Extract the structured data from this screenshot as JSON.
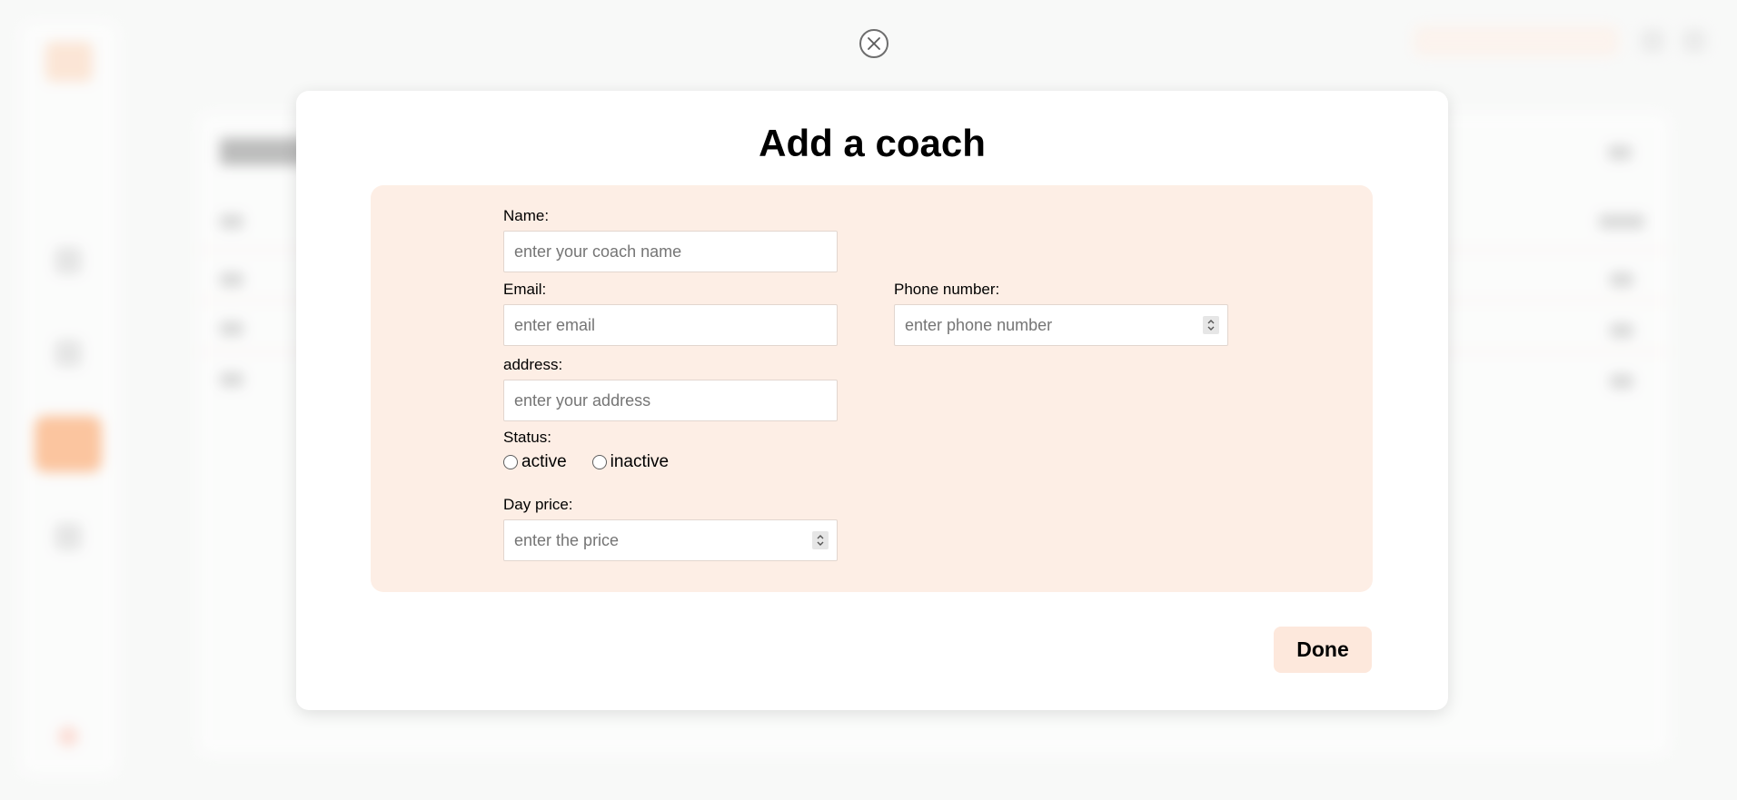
{
  "modal": {
    "title": "Add a coach",
    "close_icon": "close-circle-icon",
    "done_label": "Done"
  },
  "form": {
    "name": {
      "label": "Name:",
      "placeholder": "enter your coach name"
    },
    "email": {
      "label": "Email:",
      "placeholder": "enter email"
    },
    "phone": {
      "label": "Phone number:",
      "placeholder": "enter phone number"
    },
    "address": {
      "label": "address:",
      "placeholder": "enter your address"
    },
    "status": {
      "label": "Status:",
      "options": [
        "active",
        "inactive"
      ]
    },
    "day_price": {
      "label": "Day price:",
      "placeholder": "enter the price"
    }
  },
  "colors": {
    "accent": "#ff7a1f",
    "form_panel_bg": "#fdeee5",
    "done_button_bg": "#fde8dc"
  }
}
